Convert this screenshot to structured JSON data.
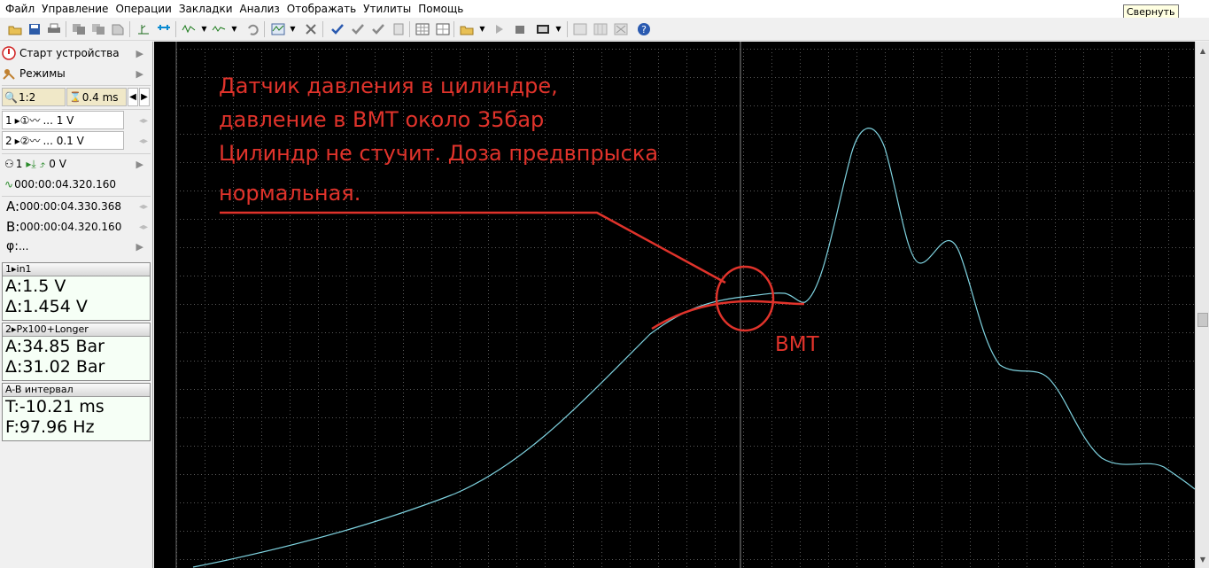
{
  "menu": [
    "Файл",
    "Управление",
    "Операции",
    "Закладки",
    "Анализ",
    "Отображать",
    "Утилиты",
    "Помощь"
  ],
  "tooltip": "Свернуть",
  "toolbar_icons": [
    "open-folder-icon",
    "save-icon",
    "print-icon",
    "copy-icon",
    "paste-icon",
    "clipboard-icon",
    "cursor-icon",
    "ruler-icon",
    "waveform-icon",
    "waveform-alt-icon",
    "undo-icon",
    "waveform-stack-icon",
    "delete-icon",
    "check-icon",
    "check-down-icon",
    "check-alt-icon",
    "page-icon",
    "grid-icon",
    "grid-alt-icon",
    "grid-x-icon",
    "folder-open-icon",
    "play-icon",
    "play-alt-icon",
    "stop-icon",
    "display-icon",
    "chart-disabled-icon",
    "chart-grid-icon",
    "chart-x-icon",
    "help-icon"
  ],
  "sidebar": {
    "start_device": "Старт устройства",
    "modes": "Режимы",
    "scale": "1:2",
    "timebase": "0.4 ms",
    "channel1": {
      "num": "1",
      "value": "... 1 V"
    },
    "channel2": {
      "num": "2",
      "value": "... 0.1 V"
    },
    "trigger": {
      "channel": "1",
      "level": "0 V"
    },
    "trigger_time": "000:00:04.320.160",
    "cursor_a": {
      "label": "A:",
      "time": "000:00:04.330.368"
    },
    "cursor_b": {
      "label": "B:",
      "time": "000:00:04.320.160"
    },
    "phase": {
      "label": "φ:",
      "value": "..."
    }
  },
  "measurements": [
    {
      "header": "1▸in1",
      "lines": [
        "A:1.5 V",
        "Δ:1.454 V"
      ]
    },
    {
      "header": "2▸Px100+Longer",
      "lines": [
        "A:34.85 Bar",
        "Δ:31.02 Bar"
      ]
    },
    {
      "header": "A-B интервал",
      "lines": [
        " T:-10.21 ms",
        " F:97.96 Hz"
      ]
    }
  ],
  "annotation": {
    "lines": [
      "Датчик давления в цилиндре,",
      "давление в ВМТ около 35бар",
      "Цилиндр не стучит. Доза предвпрыска",
      "нормальная."
    ],
    "marker_label": "ВМТ"
  },
  "colors": {
    "scope_background": "#000000",
    "grid_dots": "#5a5a5a",
    "trace": "#7fd3e0",
    "annotation": "#e0332b",
    "cursor_line": "#8c8c8c"
  }
}
